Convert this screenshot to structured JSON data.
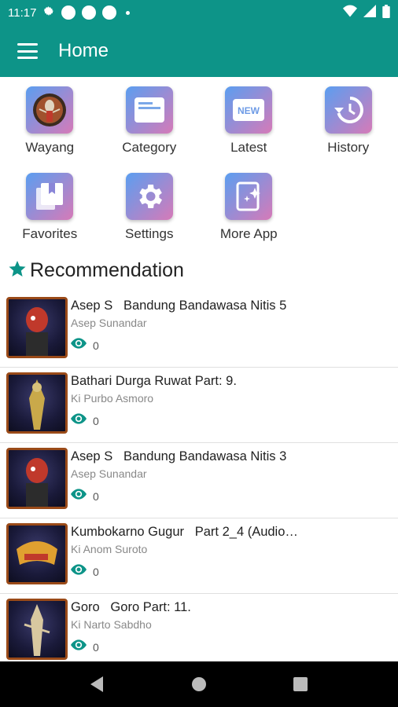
{
  "status_bar": {
    "time": "11:17"
  },
  "app_bar": {
    "title": "Home"
  },
  "grid": [
    {
      "label": "Wayang",
      "icon": "wayang-puppet-icon"
    },
    {
      "label": "Category",
      "icon": "category-card-icon"
    },
    {
      "label": "Latest",
      "icon": "new-badge-icon"
    },
    {
      "label": "History",
      "icon": "history-icon"
    },
    {
      "label": "Favorites",
      "icon": "bookmark-icon"
    },
    {
      "label": "Settings",
      "icon": "gear-icon"
    },
    {
      "label": "More App",
      "icon": "more-app-icon"
    }
  ],
  "recommendation": {
    "title": "Recommendation",
    "items": [
      {
        "title": "Asep S   Bandung Bandawasa Nitis 5",
        "author": "Asep Sunandar",
        "views": "0"
      },
      {
        "title": "Bathari Durga Ruwat Part: 9.",
        "author": "Ki Purbo Asmoro",
        "views": "0"
      },
      {
        "title": "Asep S   Bandung Bandawasa Nitis 3",
        "author": "Asep Sunandar",
        "views": "0"
      },
      {
        "title": "Kumbokarno Gugur   Part 2_4 (Audio…",
        "author": "Ki Anom Suroto",
        "views": "0"
      },
      {
        "title": "Goro   Goro Part: 11.",
        "author": "Ki Narto Sabdho",
        "views": "0"
      }
    ]
  },
  "colors": {
    "primary": "#0d9488",
    "accent_star": "#0d9488"
  }
}
